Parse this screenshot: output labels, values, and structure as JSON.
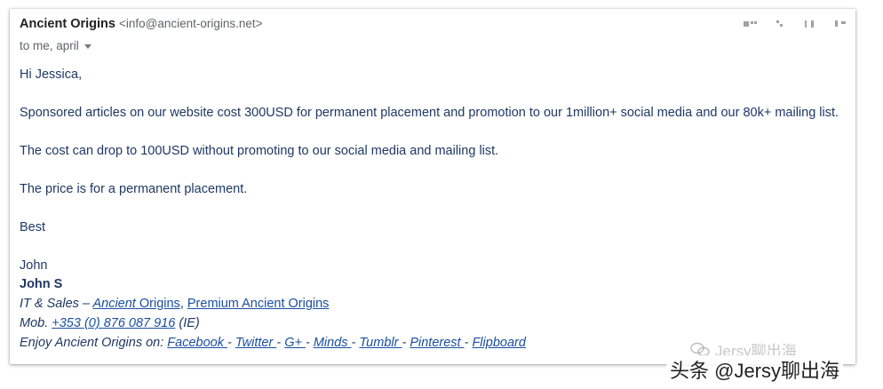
{
  "email": {
    "sender_name": "Ancient Origins",
    "sender_email": "<info@ancient-origins.net>",
    "recipients": "to me, april",
    "greeting": "Hi Jessica,",
    "paragraphs": [
      "Sponsored articles on our website cost 300USD for permanent placement and promotion to our 1million+ social media and our 80k+ mailing list.",
      "The cost can drop to 100USD without promoting to our social media and mailing list.",
      "The price is for a permanent placement.",
      "Best"
    ],
    "signoff_name": "John",
    "signature": {
      "name": "John S",
      "role_prefix": "IT & Sales – ",
      "link_ancient": "Ancient",
      "link_origins": " Origins",
      "comma": ", ",
      "link_premium": "Premium Ancient Origins",
      "mob_prefix": "Mob. ",
      "phone": "+353 (0) 876 087 916",
      "phone_suffix": " (IE)",
      "enjoy_prefix": "Enjoy Ancient Origins on: ",
      "social_links": [
        "Facebook ",
        "Twitter ",
        "G+ ",
        "Minds ",
        "Tumblr ",
        "Pinterest ",
        "Flipboard"
      ],
      "separator": "- "
    }
  },
  "watermark": {
    "line1": "Jersy聊出海",
    "line2": "头条 @Jersy聊出海"
  }
}
